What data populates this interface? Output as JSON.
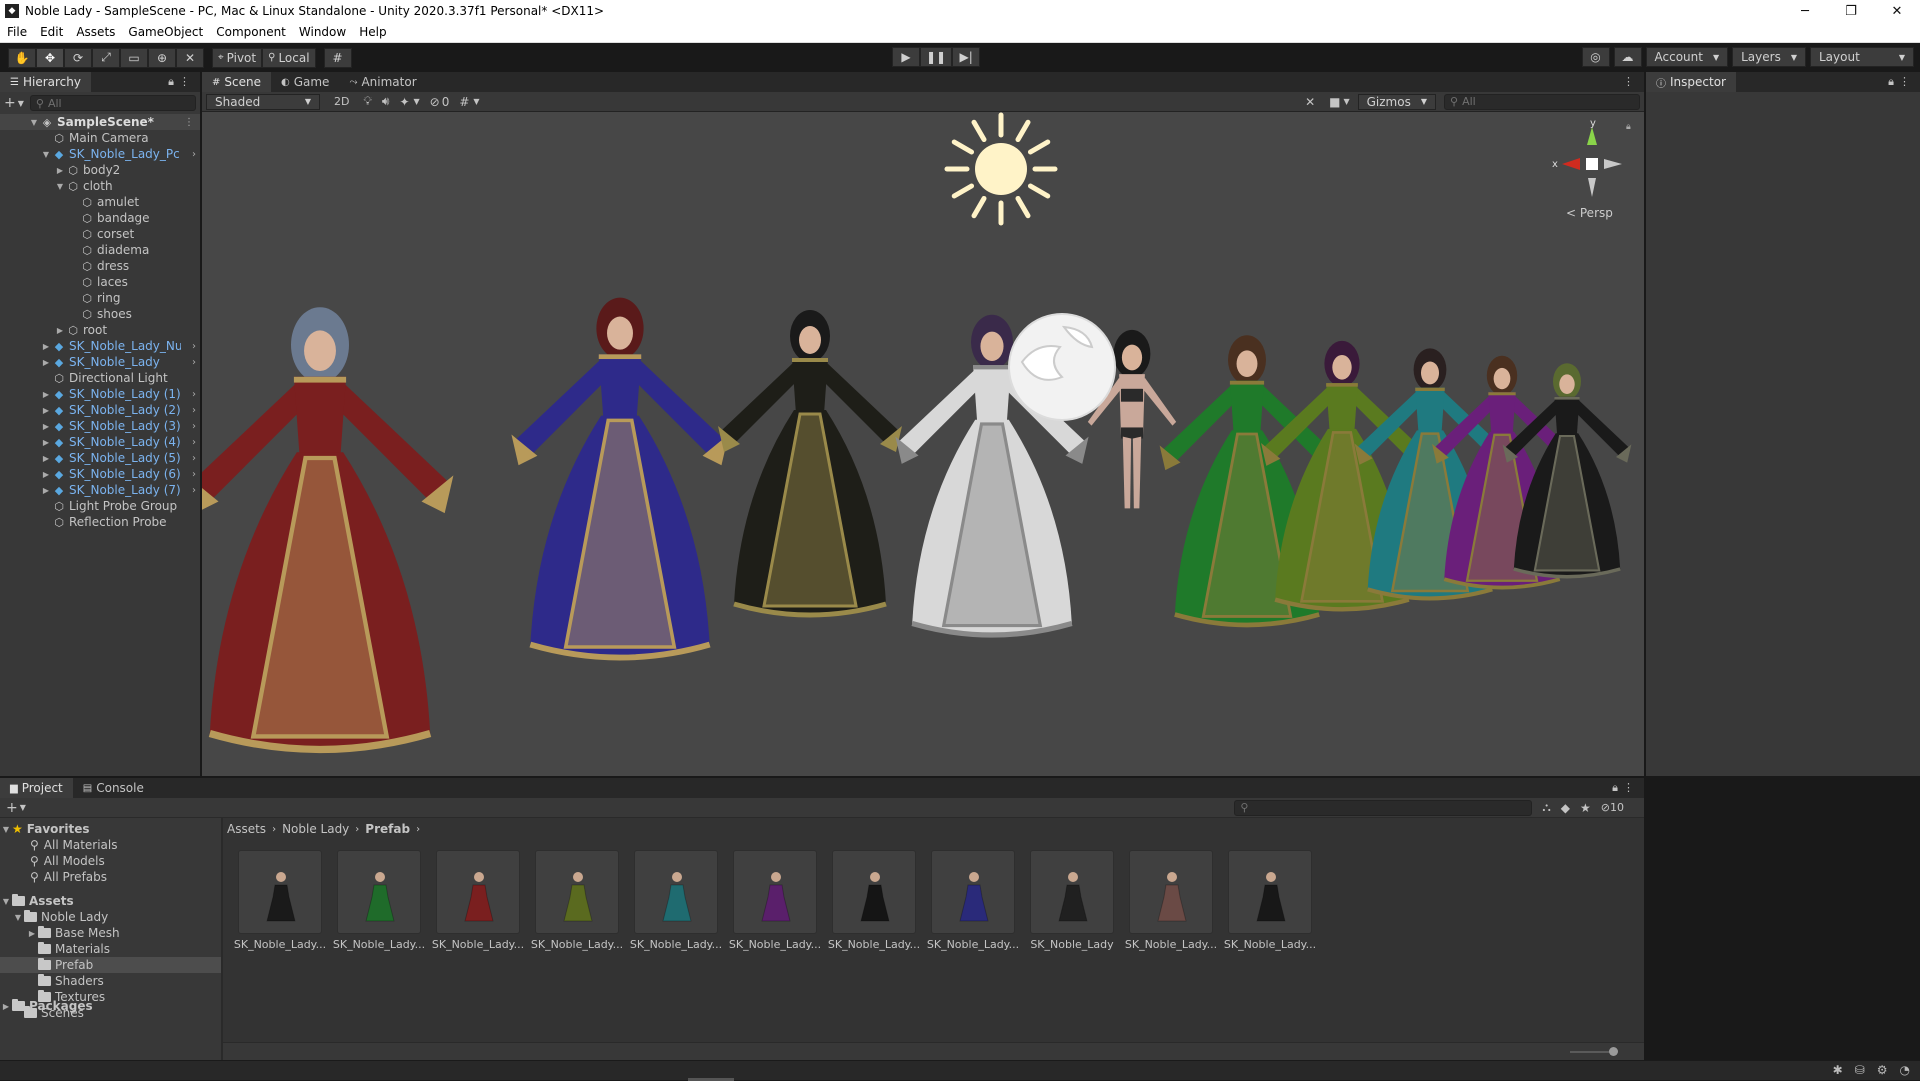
{
  "window": {
    "title": "Noble Lady - SampleScene - PC, Mac & Linux Standalone - Unity 2020.3.37f1 Personal* <DX11>",
    "controls": [
      "─",
      "❐",
      "✕"
    ]
  },
  "menu": [
    "File",
    "Edit",
    "Assets",
    "GameObject",
    "Component",
    "Window",
    "Help"
  ],
  "toolbar": {
    "pivot_label": "Pivot",
    "local_label": "Local",
    "account_label": "Account",
    "layers_label": "Layers",
    "layout_label": "Layout"
  },
  "hierarchy": {
    "tab_label": "Hierarchy",
    "search_placeholder": "All",
    "scene_name": "SampleScene*",
    "items": [
      {
        "label": "Main Camera",
        "depth": 1,
        "arrow": "",
        "prefab": false,
        "chevron": false
      },
      {
        "label": "SK_Noble_Lady_Pc",
        "depth": 1,
        "arrow": "▼",
        "prefab": true,
        "chevron": true
      },
      {
        "label": "body2",
        "depth": 2,
        "arrow": "▶",
        "prefab": false,
        "chevron": false
      },
      {
        "label": "cloth",
        "depth": 2,
        "arrow": "▼",
        "prefab": false,
        "chevron": false
      },
      {
        "label": "amulet",
        "depth": 3,
        "arrow": "",
        "prefab": false,
        "chevron": false
      },
      {
        "label": "bandage",
        "depth": 3,
        "arrow": "",
        "prefab": false,
        "chevron": false
      },
      {
        "label": "corset",
        "depth": 3,
        "arrow": "",
        "prefab": false,
        "chevron": false
      },
      {
        "label": "diadema",
        "depth": 3,
        "arrow": "",
        "prefab": false,
        "chevron": false
      },
      {
        "label": "dress",
        "depth": 3,
        "arrow": "",
        "prefab": false,
        "chevron": false
      },
      {
        "label": "laces",
        "depth": 3,
        "arrow": "",
        "prefab": false,
        "chevron": false
      },
      {
        "label": "ring",
        "depth": 3,
        "arrow": "",
        "prefab": false,
        "chevron": false
      },
      {
        "label": "shoes",
        "depth": 3,
        "arrow": "",
        "prefab": false,
        "chevron": false
      },
      {
        "label": "root",
        "depth": 2,
        "arrow": "▶",
        "prefab": false,
        "chevron": false
      },
      {
        "label": "SK_Noble_Lady_Nu",
        "depth": 1,
        "arrow": "▶",
        "prefab": true,
        "chevron": true
      },
      {
        "label": "SK_Noble_Lady",
        "depth": 1,
        "arrow": "▶",
        "prefab": true,
        "chevron": true
      },
      {
        "label": "Directional Light",
        "depth": 1,
        "arrow": "",
        "prefab": false,
        "chevron": false
      },
      {
        "label": "SK_Noble_Lady (1)",
        "depth": 1,
        "arrow": "▶",
        "prefab": true,
        "chevron": true
      },
      {
        "label": "SK_Noble_Lady (2)",
        "depth": 1,
        "arrow": "▶",
        "prefab": true,
        "chevron": true
      },
      {
        "label": "SK_Noble_Lady (3)",
        "depth": 1,
        "arrow": "▶",
        "prefab": true,
        "chevron": true
      },
      {
        "label": "SK_Noble_Lady (4)",
        "depth": 1,
        "arrow": "▶",
        "prefab": true,
        "chevron": true
      },
      {
        "label": "SK_Noble_Lady (5)",
        "depth": 1,
        "arrow": "▶",
        "prefab": true,
        "chevron": true
      },
      {
        "label": "SK_Noble_Lady (6)",
        "depth": 1,
        "arrow": "▶",
        "prefab": true,
        "chevron": true
      },
      {
        "label": "SK_Noble_Lady (7)",
        "depth": 1,
        "arrow": "▶",
        "prefab": true,
        "chevron": true
      },
      {
        "label": "Light Probe Group",
        "depth": 1,
        "arrow": "",
        "prefab": false,
        "chevron": false
      },
      {
        "label": "Reflection Probe",
        "depth": 1,
        "arrow": "",
        "prefab": false,
        "chevron": false
      }
    ]
  },
  "scene": {
    "tabs": [
      "Scene",
      "Game",
      "Animator"
    ],
    "shading": "Shaded",
    "mode_2d": "2D",
    "hidden_count": "0",
    "gizmos_label": "Gizmos",
    "search_placeholder": "All",
    "persp_label": "Persp",
    "axis_x": "x",
    "axis_y": "y"
  },
  "inspector": {
    "tab_label": "Inspector"
  },
  "project": {
    "tabs": [
      "Project",
      "Console"
    ],
    "hidden_count": "10",
    "breadcrumb": [
      "Assets",
      "Noble Lady",
      "Prefab"
    ],
    "favorites_label": "Favorites",
    "favorites": [
      "All Materials",
      "All Models",
      "All Prefabs"
    ],
    "assets_label": "Assets",
    "tree": [
      {
        "label": "Noble Lady",
        "depth": 1,
        "arrow": "▼",
        "selected": false
      },
      {
        "label": "Base Mesh",
        "depth": 2,
        "arrow": "▶",
        "selected": false
      },
      {
        "label": "Materials",
        "depth": 2,
        "arrow": "",
        "selected": false
      },
      {
        "label": "Prefab",
        "depth": 2,
        "arrow": "",
        "selected": true
      },
      {
        "label": "Shaders",
        "depth": 2,
        "arrow": "",
        "selected": false
      },
      {
        "label": "Textures",
        "depth": 2,
        "arrow": "",
        "selected": false
      },
      {
        "label": "Scenes",
        "depth": 1,
        "arrow": "",
        "selected": false
      }
    ],
    "packages_label": "Packages",
    "assets_grid": [
      {
        "label": "SK_Noble_Lady...",
        "color": "#1a1a1a"
      },
      {
        "label": "SK_Noble_Lady...",
        "color": "#1f6b2a"
      },
      {
        "label": "SK_Noble_Lady...",
        "color": "#7a1f1f"
      },
      {
        "label": "SK_Noble_Lady...",
        "color": "#5a6a1f"
      },
      {
        "label": "SK_Noble_Lady...",
        "color": "#1f6b70"
      },
      {
        "label": "SK_Noble_Lady...",
        "color": "#5a1f6b"
      },
      {
        "label": "SK_Noble_Lady...",
        "color": "#151515"
      },
      {
        "label": "SK_Noble_Lady...",
        "color": "#2a2a7a"
      },
      {
        "label": "SK_Noble_Lady",
        "color": "#202020"
      },
      {
        "label": "SK_Noble_Lady...",
        "color": "#6a4a45"
      },
      {
        "label": "SK_Noble_Lady...",
        "color": "#181818"
      }
    ]
  },
  "characters": [
    {
      "dress": "#7a1f1f",
      "trim": "#b89a5a",
      "hair": "#6b7a90"
    },
    {
      "dress": "#2e2a8a",
      "trim": "#b89a5a",
      "hair": "#5a1a1a"
    },
    {
      "dress": "#1e1e18",
      "trim": "#9a8a4a",
      "hair": "#1a1a1a"
    },
    {
      "dress": "#d8d8d8",
      "trim": "#8a8a8a",
      "hair": "#3a2a4a"
    },
    {
      "dress": "#c9a89a",
      "trim": "#2a2a2a",
      "hair": "#1a1a1a"
    },
    {
      "dress": "#1f7a2a",
      "trim": "#8a7a3a",
      "hair": "#4a3020"
    },
    {
      "dress": "#5a7a1f",
      "trim": "#8a7a3a",
      "hair": "#3a1a3a"
    },
    {
      "dress": "#1f7a80",
      "trim": "#8a7a3a",
      "hair": "#2a2020"
    },
    {
      "dress": "#6a1f7a",
      "trim": "#8a7a3a",
      "hair": "#4a3020"
    },
    {
      "dress": "#1a1a1a",
      "trim": "#6a6a5a",
      "hair": "#5a6a30"
    }
  ],
  "colors": {
    "accent": "#3a79bb",
    "prefab_blue": "#7bb3ef",
    "sun": "#fff3c8"
  }
}
